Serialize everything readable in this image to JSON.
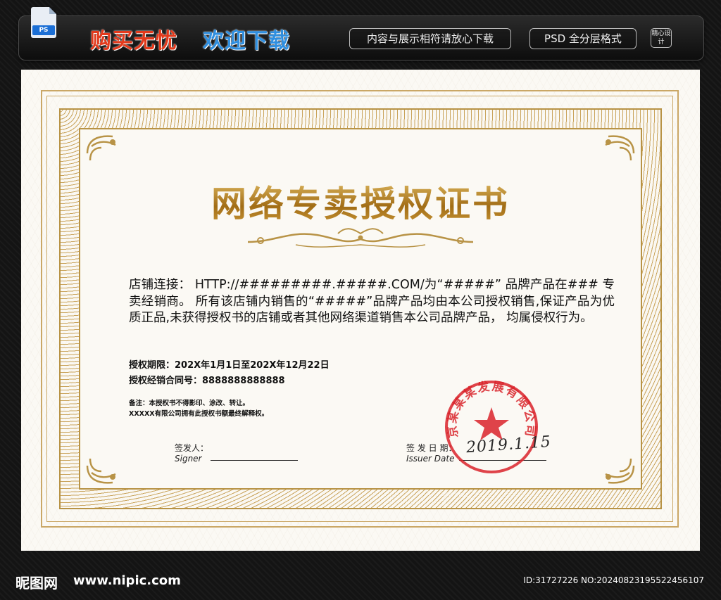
{
  "banner": {
    "ps_badge": "PS",
    "slogan_left": "购买无忧",
    "slogan_right": "欢迎下载",
    "pill_content": "内容与展示相符请放心下载",
    "pill_psd": "PSD 全分层格式",
    "seal_tag": "精心设计"
  },
  "certificate": {
    "title": "网络专卖授权证书",
    "body": "店铺连接： HTTP://#########.#####.COM/为“#####” 品牌产品在### 专卖经销商。 所有该店铺内销售的“#####”品牌产品均由本公司授权销售,保证产品为优质正品,未获得授权书的店铺或者其他网络渠道销售本公司品牌产品， 均属侵权行为。",
    "period": "授权期限：202X年1月1日至202X年12月22日",
    "contract": "授权经销合同号：8888888888888",
    "note1": "备注：本授权书不得影印、涂改、转让。",
    "note2": "XXXXX有限公司拥有此授权书额最终解释权。",
    "signer_cn": "签发人：",
    "signer_en": "Signer",
    "date_cn": "签 发 日 期：",
    "date_en": "Issuer Date",
    "stamp_text": "京某某某发展有限公司",
    "handwritten_date": "2019.1.15"
  },
  "footer": {
    "site_cn": "昵图网",
    "site_url": "www.nipic.com",
    "id": "ID:31727226 NO:20240823195522456107"
  },
  "colors": {
    "gold": "#b98428",
    "stamp_red": "#d9232a",
    "paper": "#fbf9f4"
  }
}
